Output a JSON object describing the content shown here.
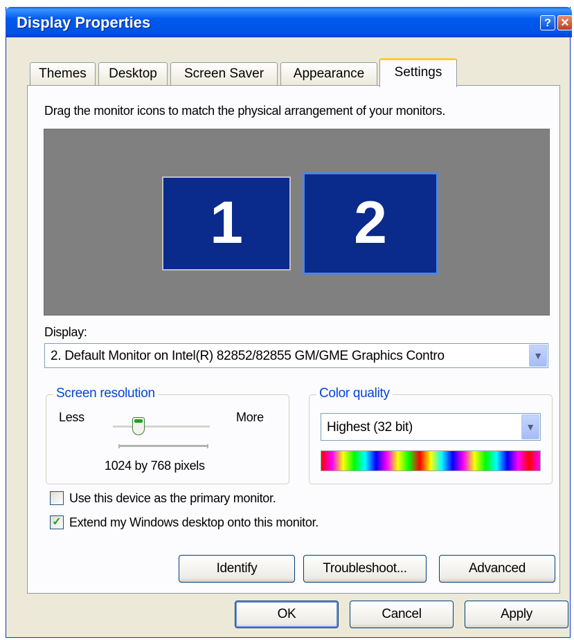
{
  "window": {
    "title": "Display Properties",
    "help_label": "?",
    "close_label": "✕"
  },
  "tabs": [
    {
      "label": "Themes"
    },
    {
      "label": "Desktop"
    },
    {
      "label": "Screen Saver"
    },
    {
      "label": "Appearance"
    },
    {
      "label": "Settings",
      "active": true
    }
  ],
  "settings": {
    "instruction": "Drag the monitor icons to match the physical arrangement of your monitors.",
    "monitors": [
      {
        "number": "1"
      },
      {
        "number": "2",
        "selected": true
      }
    ],
    "display_label": "Display:",
    "display_value": "2. Default Monitor on Intel(R) 82852/82855 GM/GME Graphics Contro",
    "resolution": {
      "title": "Screen resolution",
      "less": "Less",
      "more": "More",
      "value_text": "1024 by 768 pixels"
    },
    "color_quality": {
      "title": "Color quality",
      "selected": "Highest (32 bit)"
    },
    "primary_checkbox": {
      "label": "Use this device as the primary monitor.",
      "checked": false
    },
    "extend_checkbox": {
      "label": "Extend my Windows desktop onto this monitor.",
      "checked": true
    },
    "buttons": {
      "identify": "Identify",
      "troubleshoot": "Troubleshoot...",
      "advanced": "Advanced"
    }
  },
  "dialog_buttons": {
    "ok": "OK",
    "cancel": "Cancel",
    "apply": "Apply"
  },
  "colors": {
    "titlebar": "#0054e3",
    "monitor_fill": "#0a2a8c",
    "active_tab_accent": "#ffc83c",
    "group_title": "#0046d5"
  }
}
